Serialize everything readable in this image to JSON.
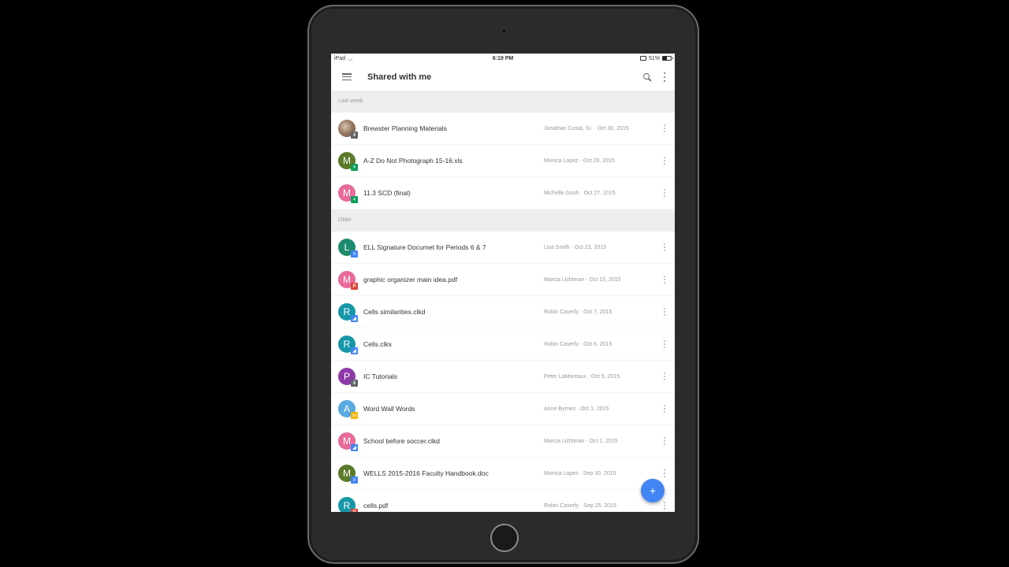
{
  "status_bar": {
    "device": "iPad",
    "wifi_icon": "wifi-icon",
    "time": "6:19 PM",
    "battery_percent": "51%",
    "battery_level": 0.51
  },
  "app_bar": {
    "menu_icon": "hamburger-menu-icon",
    "title": "Shared with me",
    "search_icon": "search-icon",
    "more_icon": "more-vert-icon"
  },
  "colors": {
    "accent": "#4285f4",
    "sheets_green": "#0f9d58",
    "docs_blue": "#4285f4",
    "pdf_red": "#db4437",
    "slides_yellow": "#f4b400",
    "generic_gray": "#5f6368"
  },
  "sections": [
    {
      "label": "Last week",
      "items": [
        {
          "name": "Brewster Planning Materials",
          "owner": "Jonathan Costa, Sr.",
          "date": "Oct 30, 2015",
          "meta": "Jonathan Costa, Sr. · Oct 30, 2015",
          "avatar_letter": "",
          "avatar_color": "photo",
          "badge": "shared-folder",
          "badge_glyph": "⇩",
          "badge_color": "#5f6368"
        },
        {
          "name": "A-Z Do Not Photograph 15-16.xls",
          "owner": "Monica Lopez",
          "date": "Oct 29, 2015",
          "meta": "Monica Lopez · Oct 29, 2015",
          "avatar_letter": "M",
          "avatar_color": "#5b7a2a",
          "badge": "sheets",
          "badge_glyph": "+",
          "badge_color": "#0f9d58"
        },
        {
          "name": "11.3 SCD (final)",
          "owner": "Michelle Gosh",
          "date": "Oct 27, 2015",
          "meta": "Michelle Gosh · Oct 27, 2015",
          "avatar_letter": "M",
          "avatar_color": "#e86a9a",
          "badge": "sheets",
          "badge_glyph": "+",
          "badge_color": "#0f9d58"
        }
      ]
    },
    {
      "label": "Older",
      "items": [
        {
          "name": "ELL Signature Documet for Periods 6 & 7",
          "owner": "Lisa Smith",
          "date": "Oct 23, 2015",
          "meta": "Lisa Smith · Oct 23, 2015",
          "avatar_letter": "L",
          "avatar_color": "#1e8a6e",
          "badge": "docs",
          "badge_glyph": "≡",
          "badge_color": "#4285f4"
        },
        {
          "name": "graphic organizer main idea.pdf",
          "owner": "Marcia Lichtman",
          "date": "Oct 15, 2015",
          "meta": "Marcia Lichtman · Oct 15, 2015",
          "avatar_letter": "M",
          "avatar_color": "#e86a9a",
          "badge": "pdf",
          "badge_glyph": "P",
          "badge_color": "#db4437"
        },
        {
          "name": "Cells similarities.clkd",
          "owner": "Robin Caverly",
          "date": "Oct 7, 2015",
          "meta": "Robin Caverly · Oct 7, 2015",
          "avatar_letter": "R",
          "avatar_color": "#1798a8",
          "badge": "app",
          "badge_glyph": "◢",
          "badge_color": "#4285f4"
        },
        {
          "name": "Cells.clks",
          "owner": "Robin Caverly",
          "date": "Oct 6, 2015",
          "meta": "Robin Caverly · Oct 6, 2015",
          "avatar_letter": "R",
          "avatar_color": "#1798a8",
          "badge": "app",
          "badge_glyph": "◢",
          "badge_color": "#4285f4"
        },
        {
          "name": "IC Tutorials",
          "owner": "Peter LaMoreaux",
          "date": "Oct 5, 2015",
          "meta": "Peter LaMoreaux · Oct 5, 2015",
          "avatar_letter": "P",
          "avatar_color": "#8e3aa8",
          "badge": "shared-folder",
          "badge_glyph": "⇩",
          "badge_color": "#5f6368"
        },
        {
          "name": "Word Wall Words",
          "owner": "Anne Byrnes",
          "date": "Oct 1, 2015",
          "meta": "Anne Byrnes · Oct 1, 2015",
          "avatar_letter": "A",
          "avatar_color": "#5aa9e0",
          "badge": "slides",
          "badge_glyph": "▭",
          "badge_color": "#f4b400"
        },
        {
          "name": "School before soccer.clkd",
          "owner": "Marcia Lichtman",
          "date": "Oct 1, 2015",
          "meta": "Marcia Lichtman · Oct 1, 2015",
          "avatar_letter": "M",
          "avatar_color": "#e86a9a",
          "badge": "app",
          "badge_glyph": "◢",
          "badge_color": "#4285f4"
        },
        {
          "name": "WELLS 2015-2016 Faculty Handbook.doc",
          "owner": "Monica Lopez",
          "date": "Sep 30, 2015",
          "meta": "Monica Lopez · Sep 30, 2015",
          "avatar_letter": "M",
          "avatar_color": "#5b7a2a",
          "badge": "docs",
          "badge_glyph": "≡",
          "badge_color": "#4285f4"
        },
        {
          "name": "cells.pdf",
          "owner": "Robin Caverly",
          "date": "Sep 25, 2015",
          "meta": "Robin Caverly · Sep 25, 2015",
          "avatar_letter": "R",
          "avatar_color": "#1798a8",
          "badge": "pdf",
          "badge_glyph": "P",
          "badge_color": "#db4437"
        }
      ]
    }
  ],
  "fab": {
    "icon": "plus-icon",
    "glyph": "+"
  }
}
